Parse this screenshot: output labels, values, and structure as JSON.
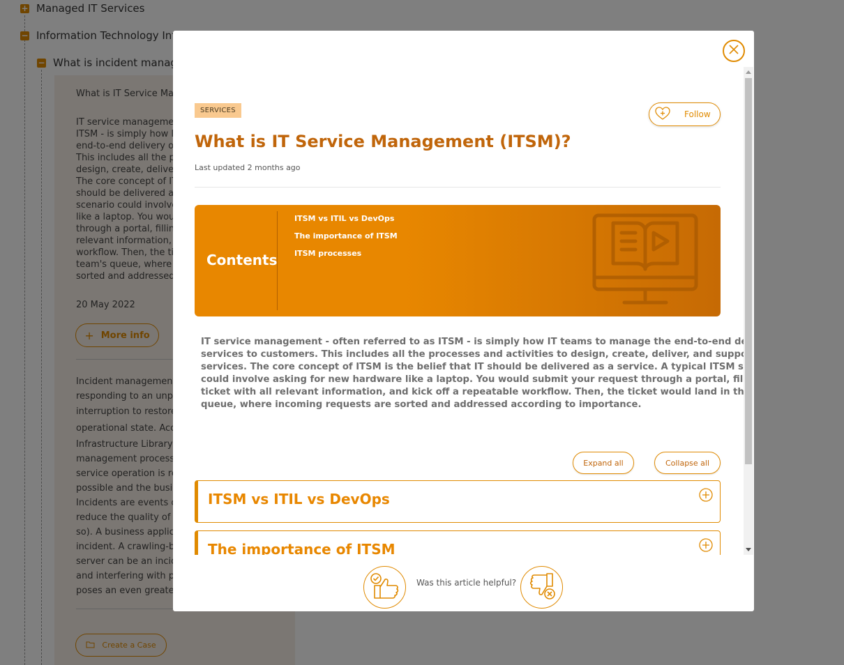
{
  "background": {
    "tree": {
      "item1": "Managed IT Services",
      "item2": "Information Technology Infr",
      "item3": "What is incident manage"
    },
    "panel": {
      "heading": "What is IT Service Man",
      "para1": [
        "IT service management",
        "ITSM - is simply how IT",
        "end-to-end delivery of",
        "This includes all the pro",
        "design, create, deliver, a",
        "The core concept of ITS",
        "should be delivered as a",
        "scenario could involve a",
        "like a laptop. You would",
        "through a portal, filling",
        "relevant information, a",
        "workflow. Then, the tic",
        "team's queue, where in",
        "sorted and addressed a"
      ],
      "date": "20 May 2022",
      "more_info": "More info",
      "para2": [
        "Incident management i",
        "responding to an unpla",
        "interruption to restore",
        "operational state. Acco",
        "Infrastructure Library),",
        "management process e",
        "service operation is res",
        "possible and the busine",
        "Incidents are events of",
        "reduce the quality of se",
        "so). A business applicat",
        "incident. A crawling-bu",
        "server can be an incide",
        "and interfering with pro",
        "poses an even greater r"
      ],
      "create_case": "Create a Case"
    }
  },
  "modal": {
    "tag": "SERVICES",
    "follow_label": "Follow",
    "title": "What is IT Service Management (ITSM)?",
    "last_updated": "Last updated 2 months ago",
    "contents": {
      "heading": "Contents",
      "links": [
        "ITSM vs ITIL vs DevOps",
        "The importance of ITSM",
        "ITSM processes"
      ]
    },
    "body_lines": [
      "IT service management - often referred to as ITSM - is simply how IT teams to manage the end-to-end delivery of IT",
      "services to customers. This includes all the processes and activities to design, create, deliver, and support IT",
      "services. The core concept of ITSM is the belief that IT should be delivered as a service. A typical ITSM scenario",
      "could involve asking for new hardware like a laptop. You would submit your request through a portal, filling out a",
      "ticket with all relevant information, and kick off a repeatable workflow. Then, the ticket would land in the IT team's",
      "queue, where incoming requests are sorted and addressed according to importance."
    ],
    "expand_all": "Expand all",
    "collapse_all": "Collapse all",
    "accordion": [
      "ITSM vs ITIL vs DevOps",
      "The importance of ITSM"
    ],
    "helpful_question": "Was this article helpful?"
  },
  "colors": {
    "accent": "#e08a00",
    "title": "#c0650a",
    "overlay": "rgba(0,0,0,0.5)"
  },
  "icons": [
    "plus-square-icon",
    "minus-square-icon",
    "close-icon",
    "heart-plus-icon",
    "book-monitor-icon",
    "plus-circle-icon",
    "thumbs-up-icon",
    "thumbs-down-icon",
    "folder-icon"
  ]
}
